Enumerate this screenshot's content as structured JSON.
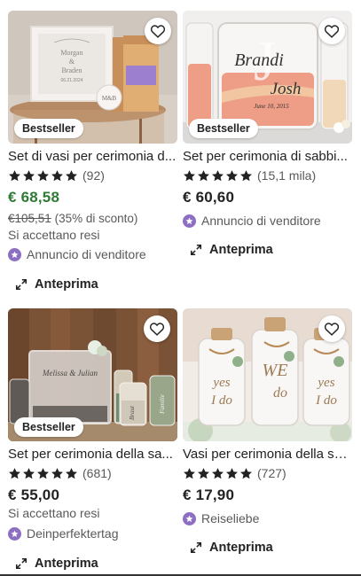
{
  "listings": [
    {
      "title": "Set di vasi per cerimonia d...",
      "badge": "Bestseller",
      "rating_count": "(92)",
      "price": "€ 68,58",
      "price_color": "#2f7a35",
      "old_price": "€105,51",
      "discount": "(35% di sconto)",
      "returns": "Si accettano resi",
      "ad_text": "Annuncio di venditore",
      "preview_label": "Anteprima",
      "image_text": [
        "Morgan",
        "&",
        "Braden",
        "06.21.2024",
        "M&B"
      ]
    },
    {
      "title": "Set per cerimonia di sabbi...",
      "badge": "Bestseller",
      "rating_count": "(15,1 mila)",
      "price": "€ 60,60",
      "price_color": "#222222",
      "ad_text": "Annuncio di venditore",
      "preview_label": "Anteprima",
      "image_text": [
        "J",
        "Brandi",
        "Josh",
        "June 10, 2015"
      ]
    },
    {
      "title": "Set per cerimonia della sa...",
      "badge": "Bestseller",
      "rating_count": "(681)",
      "price": "€ 55,00",
      "price_color": "#222222",
      "returns": "Si accettano resi",
      "ad_text": "Deinperfektertag",
      "preview_label": "Anteprima",
      "image_text": [
        "Melissa & Julian",
        "Braut",
        "Familie"
      ]
    },
    {
      "title": "Vasi per cerimonia della sa...",
      "rating_count": "(727)",
      "price": "€ 17,90",
      "price_color": "#222222",
      "ad_text": "Reiseliebe",
      "preview_label": "Anteprima",
      "image_text": [
        "yes",
        "I do",
        "WE",
        "do",
        "yes",
        "I do"
      ]
    }
  ],
  "icons": {
    "favorite": "heart-icon",
    "rating": "star-icon",
    "ad": "star-badge-icon",
    "preview": "expand-icon"
  },
  "colors": {
    "star": "#222222",
    "ad_badge": "#8c6fc2",
    "sale_price": "#2f7a35"
  }
}
